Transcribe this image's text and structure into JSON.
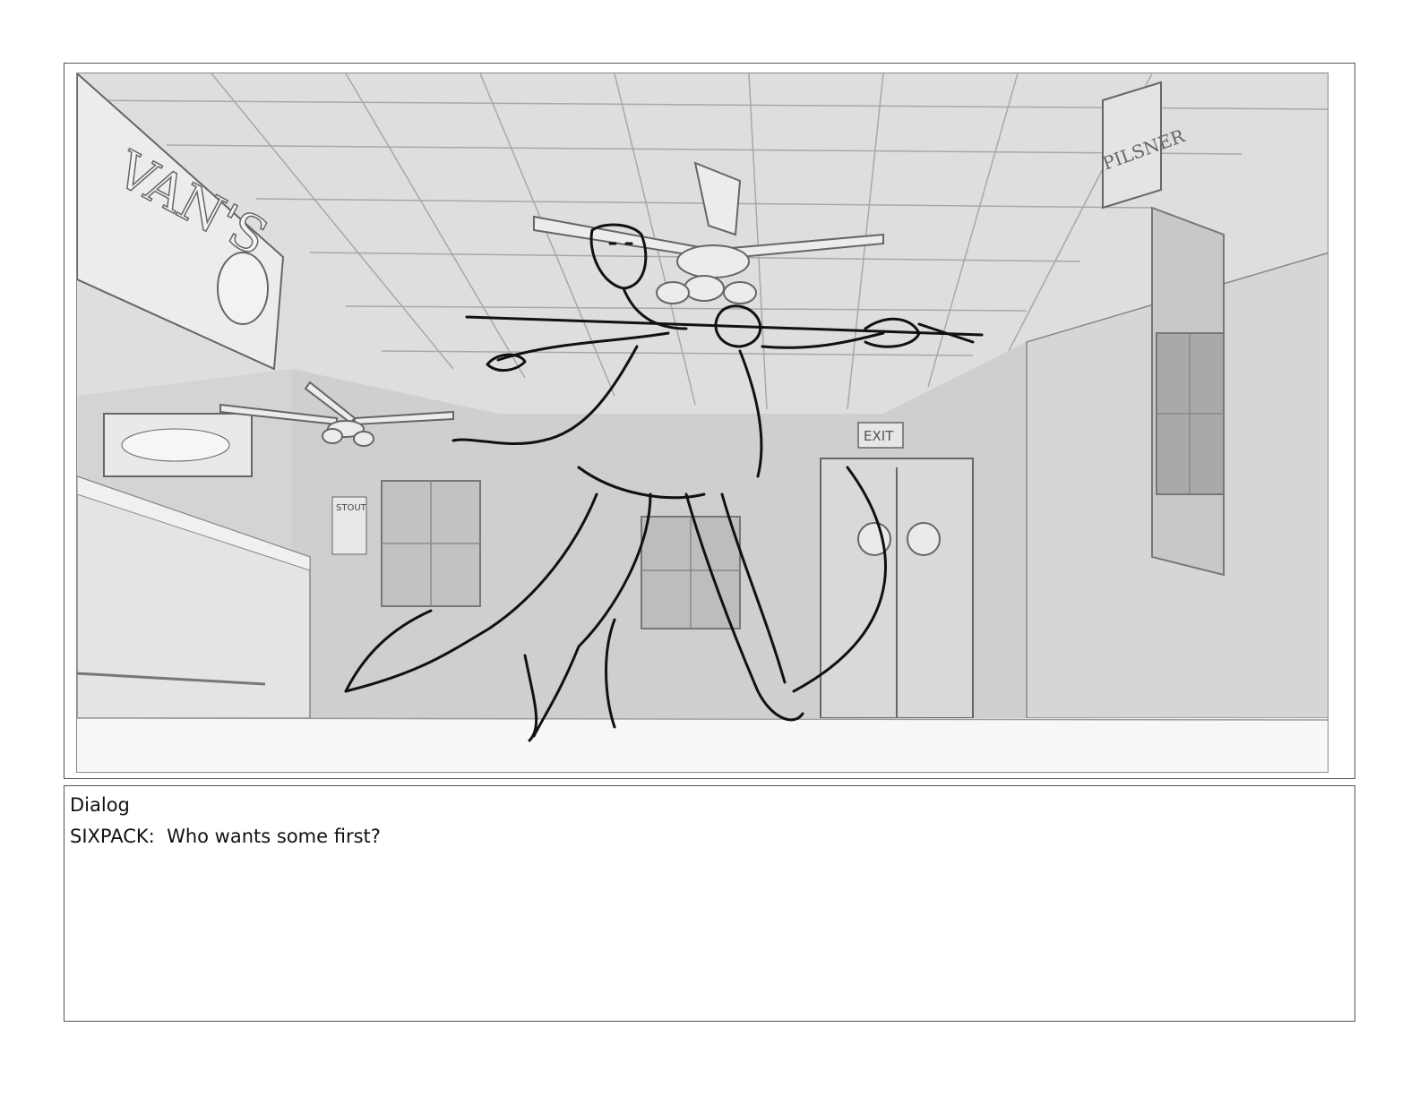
{
  "panel": {
    "scene": "storyboard-sketch",
    "signs": {
      "pub_sign": "VAN'S",
      "pilsner_sign": "PILSNER",
      "exit_sign": "EXIT",
      "stout_sign": "STOUT"
    }
  },
  "dialog": {
    "label": "Dialog",
    "line": "SIXPACK:  Who wants some first?"
  }
}
